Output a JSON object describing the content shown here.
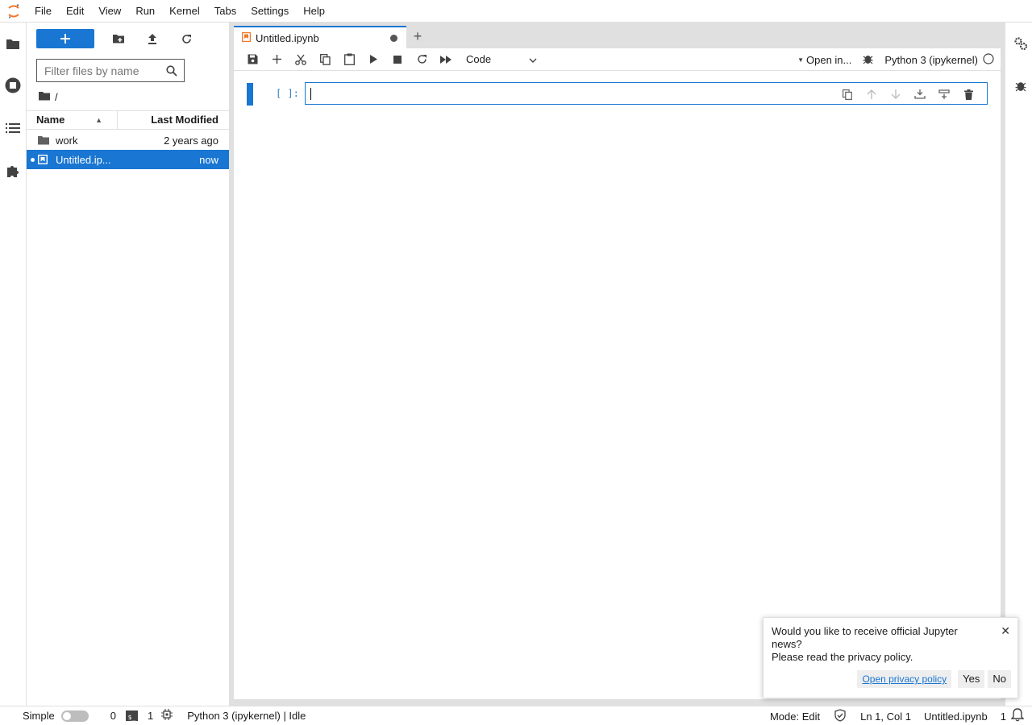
{
  "menubar": {
    "items": [
      "File",
      "Edit",
      "View",
      "Run",
      "Kernel",
      "Tabs",
      "Settings",
      "Help"
    ]
  },
  "left_bar": {
    "icons": [
      "folder-icon",
      "running-icon",
      "toc-icon",
      "extension-icon"
    ]
  },
  "filebrowser": {
    "filter_placeholder": "Filter files by name",
    "breadcrumb": "/",
    "columns": {
      "name": "Name",
      "modified": "Last Modified"
    },
    "rows": [
      {
        "name": "work",
        "modified": "2 years ago",
        "type": "folder"
      },
      {
        "name": "Untitled.ip...",
        "modified": "now",
        "type": "notebook",
        "selected": true
      }
    ]
  },
  "tabs": [
    {
      "title": "Untitled.ipynb",
      "dirty": true
    }
  ],
  "notebook_toolbar": {
    "cell_type": "Code",
    "open_in": "Open in...",
    "kernel": "Python 3 (ipykernel)"
  },
  "cell": {
    "prompt": "[ ]:",
    "source": ""
  },
  "statusbar": {
    "mode_label": "Simple",
    "terminals": "0",
    "kernels": "1",
    "kernel_status": "Python 3 (ipykernel) | Idle",
    "mode": "Mode: Edit",
    "position": "Ln 1, Col 1",
    "filename": "Untitled.ipynb",
    "notifications": "1"
  },
  "notification": {
    "line1": "Would you like to receive official Jupyter news?",
    "line2": "Please read the privacy policy.",
    "link_label": "Open privacy policy",
    "yes_label": "Yes",
    "no_label": "No"
  },
  "colors": {
    "accent": "#1976d2",
    "jupyter_orange": "#f37726"
  }
}
